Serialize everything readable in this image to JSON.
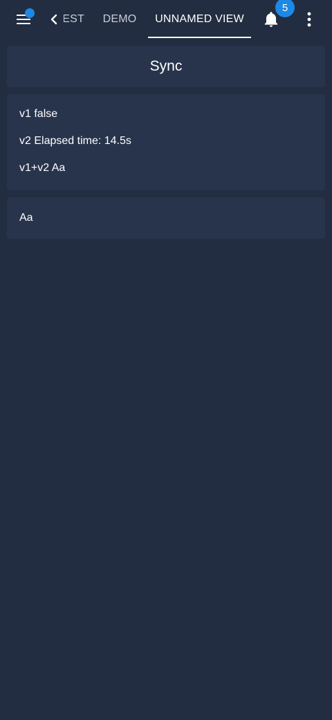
{
  "topbar": {
    "menu_icon": "hamburger-menu-icon",
    "back_icon": "chevron-left-icon",
    "tabs": [
      {
        "label": "TEST"
      },
      {
        "label": "DEMO"
      },
      {
        "label": "UNNAMED VIEW"
      }
    ],
    "active_tab": "UNNAMED VIEW",
    "notification_icon": "bell-icon",
    "notification_count": "5",
    "more_icon": "more-vertical-icon",
    "accent_color": "#1e88e5"
  },
  "sync_button": {
    "label": "Sync"
  },
  "variables": {
    "v1": {
      "name": "v1",
      "value": "false"
    },
    "v2": {
      "name": "v2",
      "value": "Elapsed time: 14.5s"
    },
    "v1v2": {
      "name": "v1+v2",
      "value": "Aa"
    }
  },
  "text_input": {
    "value": "Aa"
  },
  "colors": {
    "background": "#222d41",
    "card": "#28344c",
    "text": "#ffffff"
  }
}
